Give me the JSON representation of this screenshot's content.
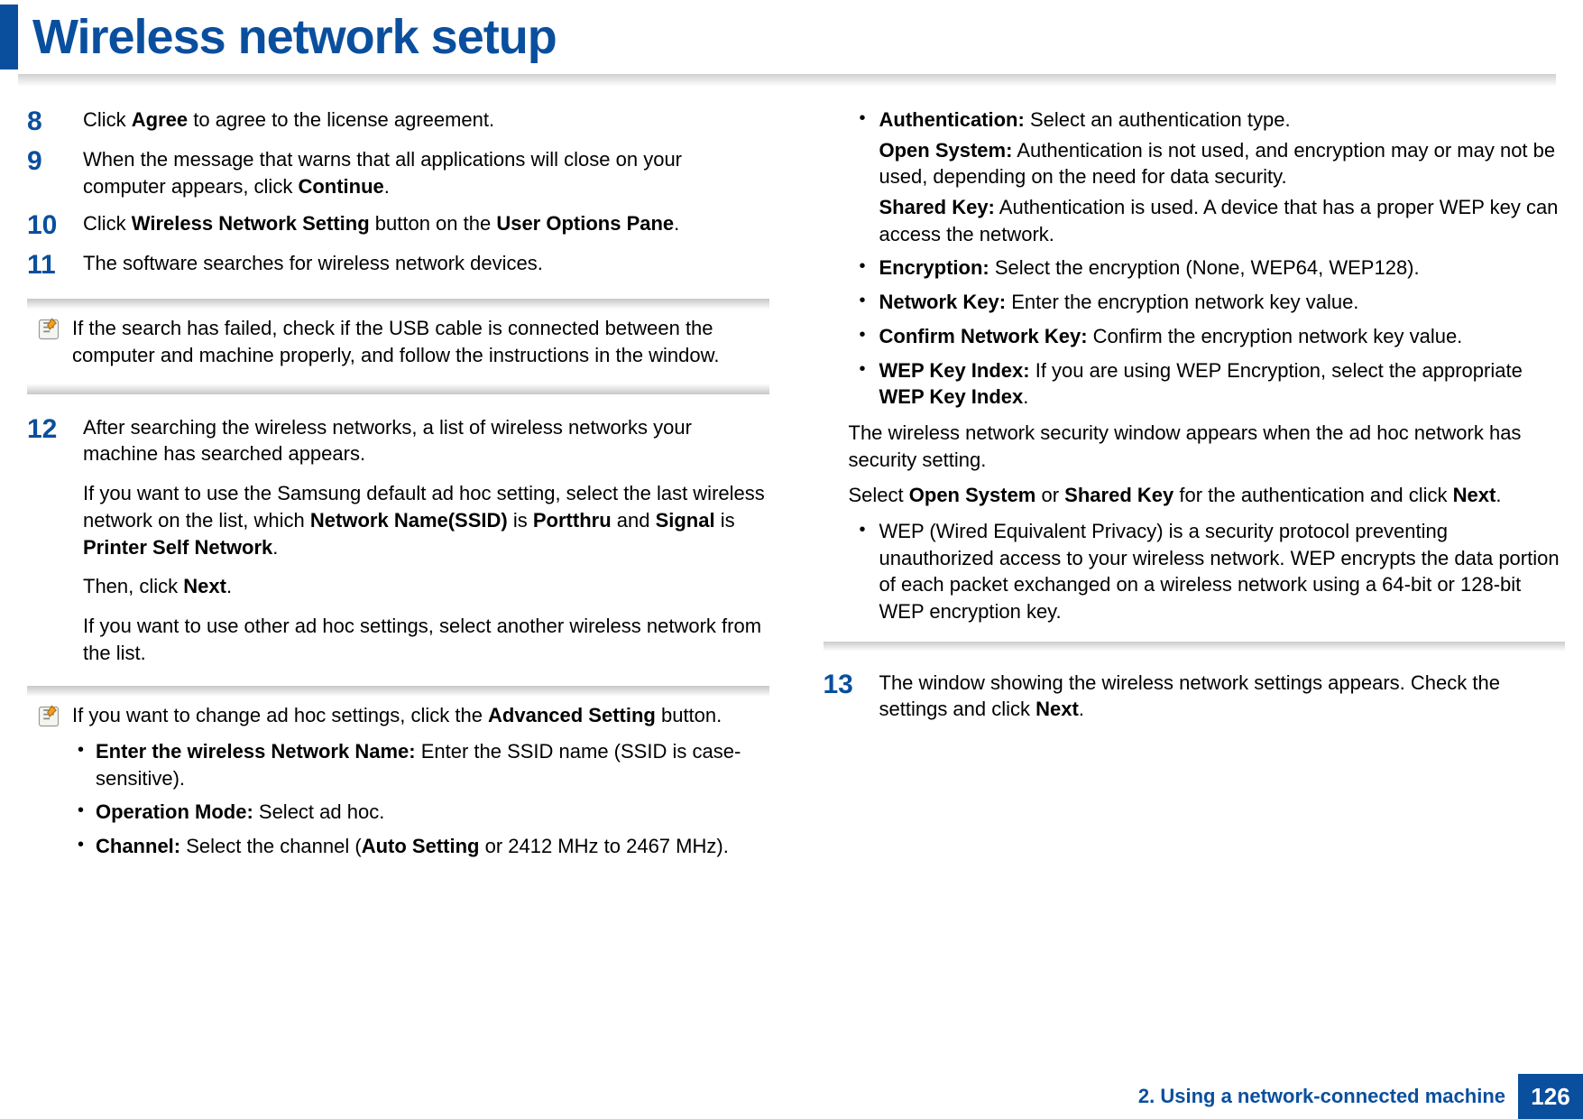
{
  "header": {
    "title": "Wireless network setup"
  },
  "left": {
    "step8": {
      "num": "8",
      "text_pre": "Click ",
      "bold1": "Agree",
      "text_post": " to agree to the license agreement."
    },
    "step9": {
      "num": "9",
      "text_pre": "When the message that warns that all applications will close on your computer appears, click ",
      "bold1": "Continue",
      "text_post": "."
    },
    "step10": {
      "num": "10",
      "text_pre": "Click ",
      "bold1": "Wireless Network Setting",
      "text_mid": " button on the ",
      "bold2": "User Options Pane",
      "text_post": "."
    },
    "step11": {
      "num": "11",
      "text": "The software searches for wireless network devices."
    },
    "note1": "If the search has failed, check if the USB cable is connected between the computer and machine properly, and follow the instructions in the window.",
    "step12": {
      "num": "12",
      "p1": "After searching the wireless networks, a list of wireless networks your machine has searched appears.",
      "p2_pre": "If you want to use the Samsung default ad hoc setting, select the last wireless network on the list, which ",
      "p2_b1": "Network Name(SSID)",
      "p2_mid1": " is ",
      "p2_b2": "Portthru",
      "p2_mid2": " and ",
      "p2_b3": "Signal",
      "p2_mid3": " is ",
      "p2_b4": "Printer Self Network",
      "p2_post": ".",
      "p3_pre": "Then, click ",
      "p3_b1": "Next",
      "p3_post": ".",
      "p4": "If you want to use other ad hoc settings, select another wireless network from the list."
    },
    "note2": {
      "lead_pre": "If you want to change ad hoc settings, click the ",
      "lead_b": "Advanced Setting",
      "lead_post": " button.",
      "b1_bold": "Enter the wireless Network Name:",
      "b1_text": " Enter the SSID name (SSID is case-sensitive).",
      "b2_bold": "Operation Mode:",
      "b2_text": " Select ad hoc.",
      "b3_bold": "Channel:",
      "b3_pre": " Select the channel (",
      "b3_b": "Auto Setting",
      "b3_post": " or 2412 MHz to 2467 MHz)."
    }
  },
  "right": {
    "bullets": {
      "auth": {
        "bold": "Authentication:",
        "text": " Select an authentication type.",
        "open_b": "Open System:",
        "open_t": " Authentication is not used, and encryption may or may not be used, depending on the need for data security.",
        "shared_b": "Shared Key:",
        "shared_t": " Authentication is used. A device that has a proper WEP key can access the network."
      },
      "enc": {
        "bold": "Encryption:",
        "text": " Select the encryption (None, WEP64, WEP128)."
      },
      "nk": {
        "bold": "Network Key:",
        "text": " Enter the encryption network key value."
      },
      "cnk": {
        "bold": "Confirm Network Key:",
        "text": " Confirm the encryption network key value."
      },
      "wki": {
        "bold": "WEP Key Index:",
        "pre": " If you are using WEP Encryption, select the appropriate ",
        "b2": "WEP Key Index",
        "post": "."
      }
    },
    "para1": "The wireless network security window appears when the ad hoc network has security setting.",
    "para2_pre": "Select ",
    "para2_b1": "Open System",
    "para2_mid": " or ",
    "para2_b2": "Shared Key",
    "para2_mid2": " for the authentication and click ",
    "para2_b3": "Next",
    "para2_post": ".",
    "wep_bullet": "WEP (Wired Equivalent Privacy) is a security protocol preventing unauthorized access to your wireless network. WEP encrypts the data portion of each packet exchanged on a wireless network using a 64-bit or 128-bit WEP encryption key.",
    "step13": {
      "num": "13",
      "pre": "The window showing the wireless network settings appears. Check the settings and click ",
      "b": "Next",
      "post": "."
    }
  },
  "footer": {
    "chapter": "2. Using a network-connected machine",
    "page": "126"
  }
}
